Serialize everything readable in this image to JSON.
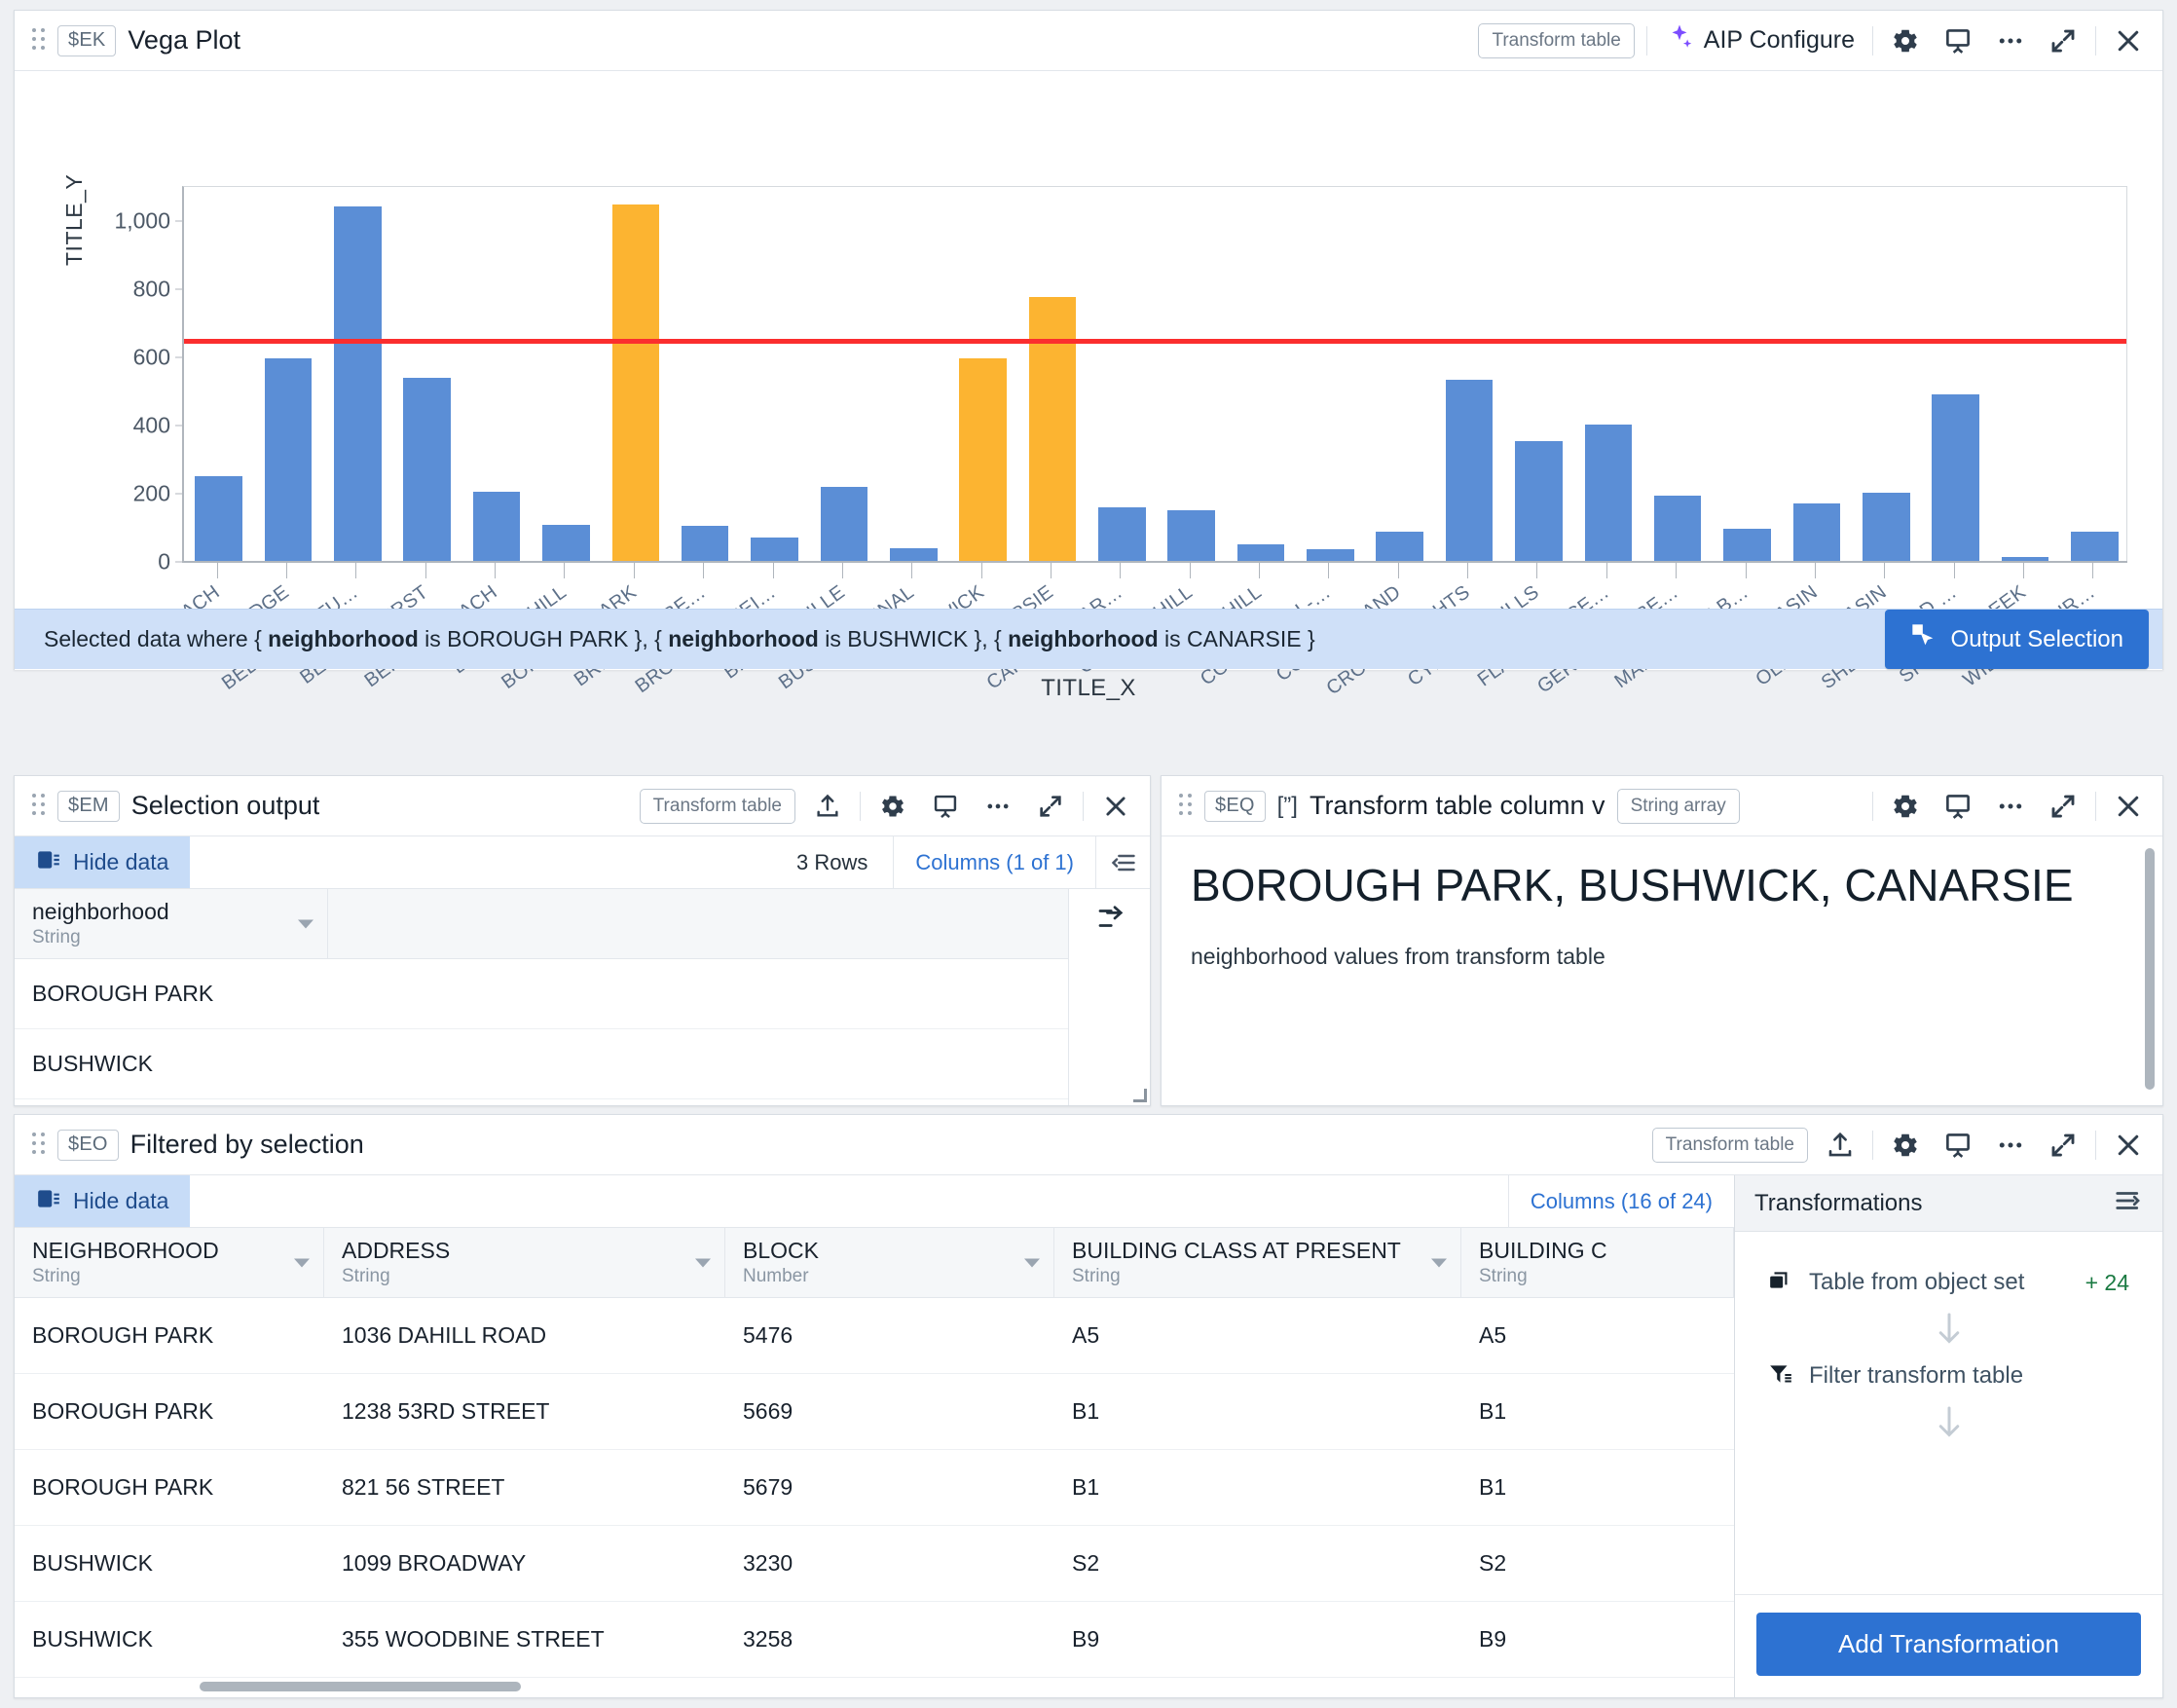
{
  "vega": {
    "var_tag": "$EK",
    "title": "Vega Plot",
    "transform_table_label": "Transform table",
    "aip_label": "AIP Configure",
    "selection_banner": {
      "prefix": "Selected data where { ",
      "field": "neighborhood",
      "clause1_mid": " is BOROUGH PARK }, { ",
      "clause2_mid": " is BUSHWICK }, { ",
      "clause3_mid": " is CANARSIE }",
      "full": "Selected data where { neighborhood is BOROUGH PARK }, { neighborhood is BUSHWICK }, { neighborhood is CANARSIE }",
      "button_label": "Output Selection"
    }
  },
  "chart_data": {
    "type": "bar",
    "title": "",
    "xlabel": "TITLE_X",
    "ylabel": "TITLE_Y",
    "ylim": [
      0,
      1100
    ],
    "yticks": [
      0,
      200,
      400,
      600,
      800,
      1000
    ],
    "ytick_labels": [
      "0",
      "200",
      "400",
      "600",
      "800",
      "1,000"
    ],
    "grid": false,
    "legend": "none",
    "rule_value": 650,
    "rule_color": "#fb2e2e",
    "bar_color": "#5b8ed6",
    "highlight_color": "#fcb431",
    "highlighted": [
      "BOROUGH PARK",
      "BUSHWICK",
      "CANARSIE"
    ],
    "categories": [
      "BATH BEACH",
      "BAY RIDGE",
      "BEDFORD STU…",
      "BENSONHURST",
      "BERGEN BEACH",
      "BOERUM HILL",
      "BOROUGH PARK",
      "BRIGHTON BE…",
      "BROOKLYN HEI…",
      "BROWNSVILLE",
      "BUSH TERMINAL",
      "BUSHWICK",
      "CANARSIE",
      "CARROLL GAR…",
      "CLINTON HILL",
      "COBBLE HILL",
      "COBBLE HILL-…",
      "CONEY ISLAND",
      "CROWN HEIGHTS",
      "CYPRESS HILLS",
      "FLATBUSH-CE…",
      "GERRITSEN BE…",
      "MANHATTAN B…",
      "MILL BASIN",
      "OLD MILL BASIN",
      "SHEEPSHEAD …",
      "SPRING CREEK",
      "WILLIAMSBUR…"
    ],
    "values": [
      250,
      595,
      1040,
      538,
      203,
      105,
      1045,
      102,
      68,
      218,
      38,
      595,
      775,
      158,
      148,
      48,
      35,
      85,
      532,
      352,
      400,
      192,
      95,
      168,
      200,
      490,
      12,
      85
    ]
  },
  "selection_output": {
    "var_tag": "$EM",
    "title": "Selection output",
    "transform_table_label": "Transform table",
    "hide_data_label": "Hide data",
    "rows_label": "3 Rows",
    "columns_label": "Columns (1 of 1)",
    "columns": [
      {
        "name": "neighborhood",
        "type": "String"
      }
    ],
    "rows": [
      [
        "BOROUGH PARK"
      ],
      [
        "BUSHWICK"
      ]
    ]
  },
  "transform_column": {
    "var_tag": "$EQ",
    "title": "Transform table column v",
    "type_pill": "String array",
    "value": "BOROUGH PARK, BUSHWICK, CANARSIE",
    "caption": "neighborhood values from transform table"
  },
  "filtered": {
    "var_tag": "$EO",
    "title": "Filtered by selection",
    "transform_table_label": "Transform table",
    "hide_data_label": "Hide data",
    "columns_label": "Columns (16 of 24)",
    "columns": [
      {
        "name": "NEIGHBORHOOD",
        "type": "String"
      },
      {
        "name": "ADDRESS",
        "type": "String"
      },
      {
        "name": "BLOCK",
        "type": "Number"
      },
      {
        "name": "BUILDING CLASS AT PRESENT",
        "type": "String"
      },
      {
        "name": "BUILDING C",
        "type": "String"
      }
    ],
    "rows": [
      [
        "BOROUGH PARK",
        "1036 DAHILL ROAD",
        "5476",
        "A5",
        "A5"
      ],
      [
        "BOROUGH PARK",
        "1238 53RD STREET",
        "5669",
        "B1",
        "B1"
      ],
      [
        "BOROUGH PARK",
        "821 56 STREET",
        "5679",
        "B1",
        "B1"
      ],
      [
        "BUSHWICK",
        "1099 BROADWAY",
        "3230",
        "S2",
        "S2"
      ],
      [
        "BUSHWICK",
        "355 WOODBINE STREET",
        "3258",
        "B9",
        "B9"
      ]
    ]
  },
  "transformations": {
    "title": "Transformations",
    "items": [
      {
        "label": "Table from object set",
        "badge": "+ 24",
        "icon": "stack-icon"
      },
      {
        "label": "Filter transform table",
        "badge": "",
        "icon": "filter-icon"
      }
    ],
    "add_button": "Add Transformation"
  }
}
